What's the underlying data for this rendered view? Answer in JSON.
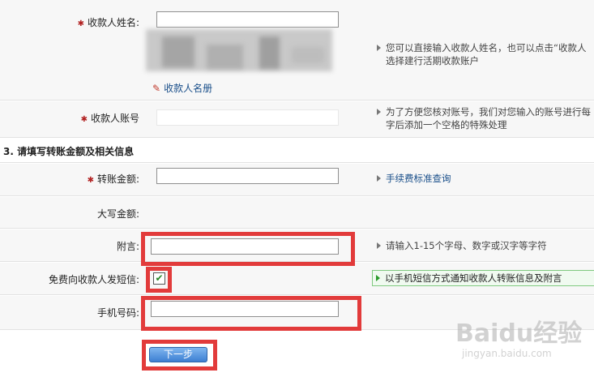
{
  "payee_name": {
    "label": "收款人姓名:",
    "hint_line1": "您可以直接输入收款人姓名，也可以点击“收款人",
    "hint_line2": "选择建行活期收款账户",
    "payee_book_link": "收款人名册",
    "payee_book_icon": "pencil-icon"
  },
  "payee_account": {
    "label": "收款人账号",
    "hint_line1": "为了方便您核对账号，我们对您输入的账号进行每",
    "hint_line2": "字后添加一个空格的特殊处理"
  },
  "section_title": "3. 请填写转账金额及相关信息",
  "amount": {
    "label": "转账金额:",
    "fee_link": "手续费标准查询"
  },
  "amount_upper": {
    "label": "大写金额:"
  },
  "memo": {
    "label": "附言:",
    "value": "",
    "hint": "请输入1-15个字母、数字或汉字等字符"
  },
  "sms": {
    "label": "免费向收款人发短信:",
    "checked": true,
    "hint": "以手机短信方式通知收款人转账信息及附言"
  },
  "phone": {
    "label": "手机号码:",
    "value": ""
  },
  "next_button": "下一步",
  "watermark": {
    "line1": "Baidu经验",
    "line2": "jingyan.baidu.com"
  },
  "colors": {
    "highlight": "#e23b3b",
    "link": "#1a4f8a",
    "button": "#4a8fe0"
  }
}
